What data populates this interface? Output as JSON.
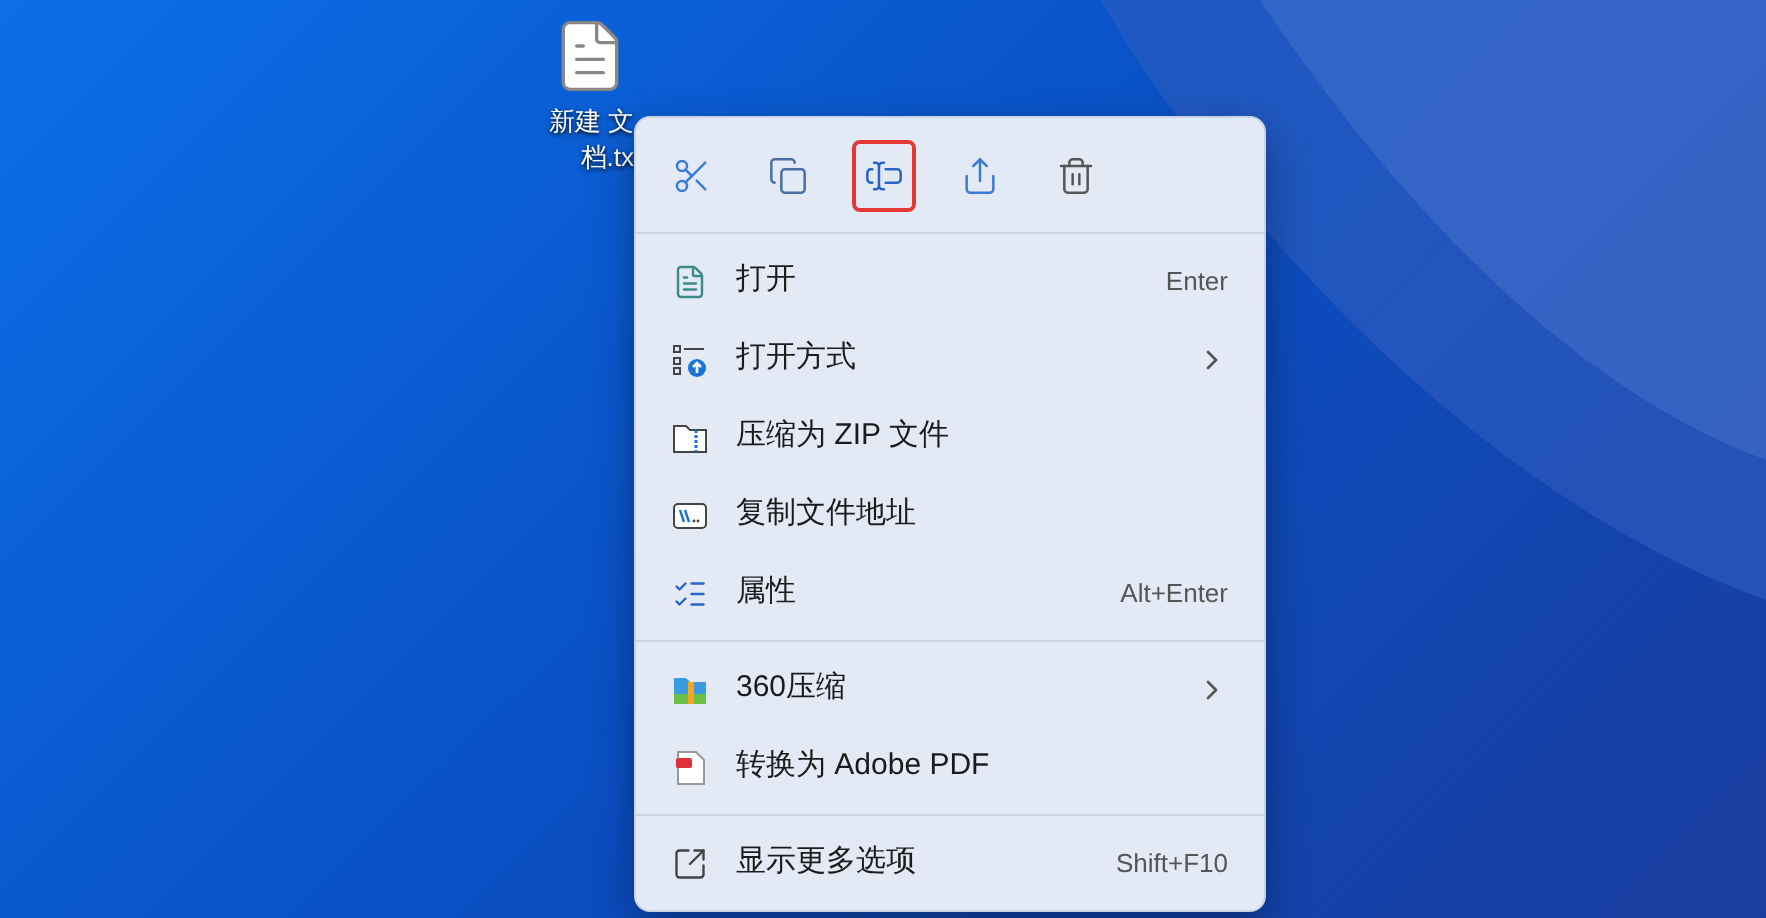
{
  "desktop_icon": {
    "label_lines": [
      "新建 文",
      "档.tx"
    ]
  },
  "context_menu": {
    "toolbar": [
      {
        "kind": "cut",
        "highlighted": false
      },
      {
        "kind": "copy",
        "highlighted": false
      },
      {
        "kind": "rename",
        "highlighted": true
      },
      {
        "kind": "share",
        "highlighted": false
      },
      {
        "kind": "delete",
        "highlighted": false
      }
    ],
    "groups": [
      [
        {
          "kind": "notepad",
          "label": "打开",
          "shortcut": "Enter",
          "submenu": false
        },
        {
          "kind": "openwith",
          "label": "打开方式",
          "submenu": true
        },
        {
          "kind": "zip",
          "label": "压缩为 ZIP 文件",
          "submenu": false
        },
        {
          "kind": "path",
          "label": "复制文件地址",
          "submenu": false
        },
        {
          "kind": "properties",
          "label": "属性",
          "shortcut": "Alt+Enter",
          "submenu": false
        }
      ],
      [
        {
          "kind": "archive",
          "label": "360压缩",
          "submenu": true
        },
        {
          "kind": "pdf",
          "label": "转换为 Adobe PDF",
          "submenu": false
        }
      ],
      [
        {
          "kind": "more",
          "label": "显示更多选项",
          "shortcut": "Shift+F10",
          "submenu": false
        }
      ]
    ]
  }
}
